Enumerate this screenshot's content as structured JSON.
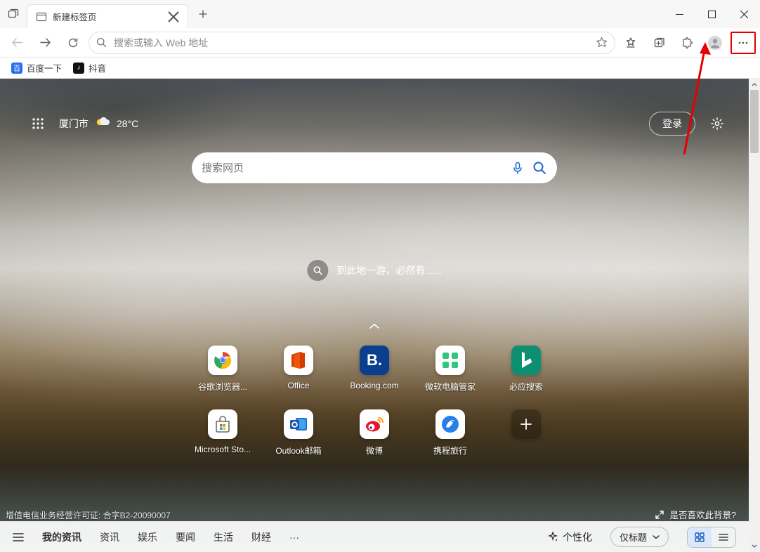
{
  "tab": {
    "title": "新建标签页"
  },
  "addressbar": {
    "placeholder": "搜索或输入 Web 地址"
  },
  "bookmarks": [
    {
      "label": "百度一下",
      "bg": "#2a6def",
      "glyph": "百"
    },
    {
      "label": "抖音",
      "bg": "#111111",
      "glyph": "♪"
    }
  ],
  "ntp": {
    "city": "厦门市",
    "temp": "28°C",
    "login": "登录",
    "search_placeholder": "搜索网页",
    "visit_text": "到此地一游，必然有......",
    "license": "增值电信业务经营许可证: 合字B2-20090007",
    "like_bg": "是否喜欢此背景?"
  },
  "tiles": [
    {
      "label": "谷歌浏览器...",
      "bg": "#ffffff",
      "svg": "chrome"
    },
    {
      "label": "Office",
      "bg": "#ffffff",
      "svg": "office"
    },
    {
      "label": "Booking.com",
      "bg": "#0b3e8f",
      "svg": "booking"
    },
    {
      "label": "微软电脑管家",
      "bg": "#ffffff",
      "svg": "grid4"
    },
    {
      "label": "必应搜索",
      "bg": "#0f8f72",
      "svg": "bing"
    },
    {
      "label": "Microsoft Sto...",
      "bg": "#ffffff",
      "svg": "store"
    },
    {
      "label": "Outlook邮箱",
      "bg": "#ffffff",
      "svg": "outlook"
    },
    {
      "label": "微博",
      "bg": "#ffffff",
      "svg": "weibo"
    },
    {
      "label": "携程旅行",
      "bg": "#ffffff",
      "svg": "ctrip"
    }
  ],
  "feed": {
    "items": [
      "我的资讯",
      "资讯",
      "娱乐",
      "要闻",
      "生活",
      "财经"
    ],
    "personalize": "个性化",
    "layout": "仅标题"
  }
}
